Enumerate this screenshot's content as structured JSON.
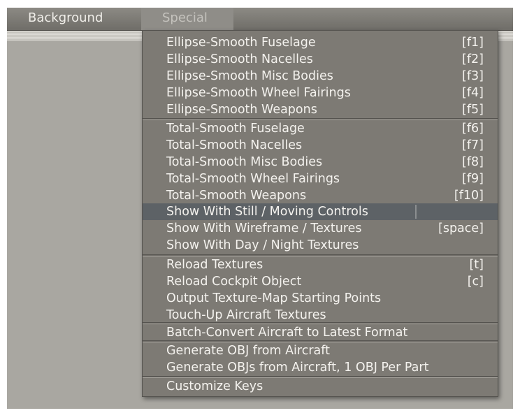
{
  "menubar": {
    "background_label": "Background",
    "special_label": "Special"
  },
  "menu": {
    "items": [
      {
        "label": "Ellipse-Smooth Fuselage",
        "key": "[f1]"
      },
      {
        "label": "Ellipse-Smooth Nacelles",
        "key": "[f2]"
      },
      {
        "label": "Ellipse-Smooth Misc Bodies",
        "key": "[f3]"
      },
      {
        "label": "Ellipse-Smooth Wheel Fairings",
        "key": "[f4]"
      },
      {
        "label": "Ellipse-Smooth Weapons",
        "key": "[f5]"
      },
      {
        "label": "Total-Smooth Fuselage",
        "key": "[f6]"
      },
      {
        "label": "Total-Smooth Nacelles",
        "key": "[f7]"
      },
      {
        "label": "Total-Smooth Misc Bodies",
        "key": "[f8]"
      },
      {
        "label": "Total-Smooth Wheel Fairings",
        "key": "[f9]"
      },
      {
        "label": "Total-Smooth Weapons",
        "key": "[f10]"
      },
      {
        "label": "Show With Still / Moving Controls",
        "key": ""
      },
      {
        "label": "Show With Wireframe / Textures",
        "key": "[space]"
      },
      {
        "label": "Show With Day / Night Textures",
        "key": ""
      },
      {
        "label": "Reload Textures",
        "key": "[t]"
      },
      {
        "label": "Reload Cockpit Object",
        "key": "[c]"
      },
      {
        "label": "Output Texture-Map Starting Points",
        "key": ""
      },
      {
        "label": "Touch-Up Aircraft Textures",
        "key": ""
      },
      {
        "label": "Batch-Convert Aircraft to Latest Format",
        "key": ""
      },
      {
        "label": "Generate OBJ from Aircraft",
        "key": ""
      },
      {
        "label": "Generate OBJs from Aircraft, 1 OBJ Per Part",
        "key": ""
      },
      {
        "label": "Customize Keys",
        "key": ""
      }
    ]
  }
}
